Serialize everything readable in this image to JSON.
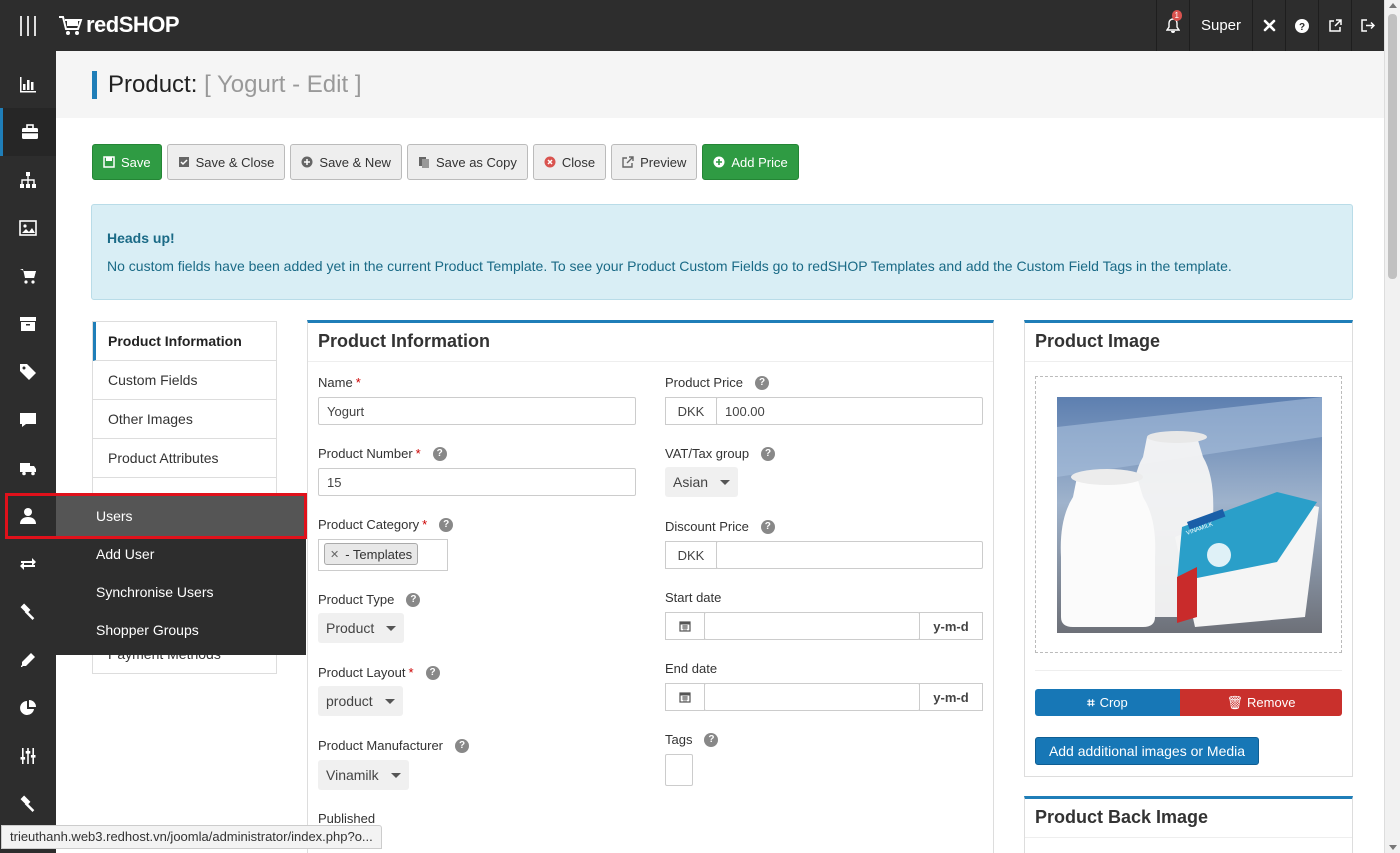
{
  "app": {
    "brand": "redSHOP"
  },
  "topbar": {
    "notification_count": "1",
    "user": "Super"
  },
  "page": {
    "title_main": "Product:",
    "title_sub": "[ Yogurt - Edit ]"
  },
  "toolbar": {
    "save": "Save",
    "save_close": "Save & Close",
    "save_new": "Save & New",
    "save_copy": "Save as Copy",
    "close": "Close",
    "preview": "Preview",
    "add_price": "Add Price"
  },
  "alert": {
    "heading": "Heads up!",
    "text": "No custom fields have been added yet in the current Product Template. To see your Product Custom Fields go to redSHOP Templates and add the Custom Field Tags in the template."
  },
  "tabs": [
    "Product Information",
    "Custom Fields",
    "Other Images",
    "Product Attributes",
    "Payment Methods"
  ],
  "flyout": {
    "items": [
      "Users",
      "Add User",
      "Synchronise Users",
      "Shopper Groups"
    ]
  },
  "product_info": {
    "title": "Product Information",
    "name_label": "Name",
    "name_value": "Yogurt",
    "number_label": "Product Number",
    "number_value": "15",
    "category_label": "Product Category",
    "category_value": "- Templates",
    "type_label": "Product Type",
    "type_value": "Product",
    "layout_label": "Product Layout",
    "layout_value": "product",
    "manufacturer_label": "Product Manufacturer",
    "manufacturer_value": "Vinamilk",
    "published_label": "Published",
    "price_label": "Product Price",
    "currency": "DKK",
    "price_value": "100.00",
    "vat_label": "VAT/Tax group",
    "vat_value": "Asian",
    "discount_label": "Discount Price",
    "discount_currency": "DKK",
    "start_label": "Start date",
    "start_format": "y-m-d",
    "end_label": "End date",
    "end_format": "y-m-d",
    "tags_label": "Tags"
  },
  "product_image": {
    "title": "Product Image",
    "crop": "Crop",
    "remove": "Remove",
    "add_media": "Add additional images or Media",
    "package_text": "VINAMILK"
  },
  "product_back_image": {
    "title": "Product Back Image"
  },
  "statusbar": {
    "url": "trieuthanh.web3.redhost.vn/joomla/administrator/index.php?o..."
  }
}
